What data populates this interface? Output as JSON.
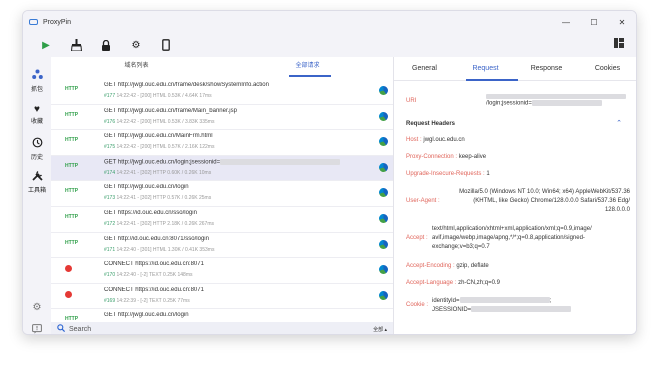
{
  "app": {
    "title": "ProxyPin"
  },
  "window_controls": {
    "minimize": "—",
    "maximize": "☐",
    "close": "✕"
  },
  "sidebar": {
    "items": [
      {
        "label": "抓包",
        "icon": "share-nodes-icon"
      },
      {
        "label": "收藏",
        "icon": "heart-icon"
      },
      {
        "label": "历史",
        "icon": "history-icon"
      },
      {
        "label": "工具箱",
        "icon": "tools-icon"
      }
    ]
  },
  "list": {
    "tabs": [
      {
        "label": "域名列表"
      },
      {
        "label": "全部请求"
      }
    ],
    "rows": [
      {
        "url": "GET http://jwgl.ouc.edu.cn/frame/desk/showSystemInfo.action",
        "meta_id": "#177",
        "meta": "14:22:42 - [200]  HTML 0.53K / 4.64K  17ms",
        "kind": "ok"
      },
      {
        "url": "GET http://jwgl.ouc.edu.cn/frame/Main_banner.jsp",
        "meta_id": "#176",
        "meta": "14:22:42 - [200]  HTML 0.53K / 3.83K  335ms",
        "kind": "ok"
      },
      {
        "url": "GET http://jwgl.ouc.edu.cn/MainFrm.html",
        "meta_id": "#175",
        "meta": "14:22:42 - [200]  HTML 0.57K / 2.16K  122ms",
        "kind": "ok"
      },
      {
        "url": "GET http://jwgl.ouc.edu.cn/login;jsessionid=",
        "meta_id": "#174",
        "meta": "14:22:41 - [302]  HTTP 0.60K / 0.26K  10ms",
        "kind": "ok"
      },
      {
        "url": "GET http://jwgl.ouc.edu.cn/login",
        "meta_id": "#173",
        "meta": "14:22:41 - [302]  HTTP 0.57K / 0.26K  25ms",
        "kind": "ok"
      },
      {
        "url": "GET https://id.ouc.edu.cn/sso/login",
        "meta_id": "#172",
        "meta": "14:22:41 - [302]  HTTP 2.18K / 0.26K  267ms",
        "kind": "ok"
      },
      {
        "url": "GET http://id.ouc.edu.cn:8071/sso/login",
        "meta_id": "#171",
        "meta": "14:22:40 - [301]  HTML 1.30K / 0.41K  353ms",
        "kind": "ok"
      },
      {
        "url": "CONNECT https://id.ouc.edu.cn:8071",
        "meta_id": "#170",
        "meta": "14:22:40 - [-2]  TEXT 0.25K  148ms",
        "kind": "err"
      },
      {
        "url": "CONNECT https://id.ouc.edu.cn:8071",
        "meta_id": "#169",
        "meta": "14:22:39 - [-2]  TEXT 0.25K  77ms",
        "kind": "err"
      },
      {
        "url": "GET http://jwgl.ouc.edu.cn/login",
        "meta_id": "",
        "meta": "",
        "kind": "ok"
      }
    ]
  },
  "search": {
    "placeholder": "Search",
    "scope": "全部 ▴"
  },
  "detail": {
    "tabs": [
      {
        "label": "General"
      },
      {
        "label": "Request"
      },
      {
        "label": "Response"
      },
      {
        "label": "Cookies"
      }
    ],
    "uri_label": "URI",
    "uri_value": "/login;jsessionid=",
    "section_title": "Request Headers",
    "headers": [
      {
        "key": "Host",
        "value": "jwgl.ouc.edu.cn"
      },
      {
        "key": "Proxy-Connection",
        "value": "keep-alive"
      },
      {
        "key": "Upgrade-Insecure-Requests",
        "value": "1"
      },
      {
        "key": "User-Agent",
        "value_lines": [
          "Mozilla/5.0 (Windows NT 10.0; Win64; x64) AppleWebKit/537.36",
          "(KHTML, like Gecko) Chrome/128.0.0.0 Safari/537.36 Edg/",
          "128.0.0.0"
        ]
      },
      {
        "key": "Accept",
        "value_lines": [
          "text/html,application/xhtml+xml,application/xml;q=0.9,image/",
          "avif,image/webp,image/apng,*/*;q=0.8,application/signed-",
          "exchange;v=b3;q=0.7"
        ]
      },
      {
        "key": "Accept-Encoding",
        "value": "gzip, deflate"
      },
      {
        "key": "Accept-Language",
        "value": "zh-CN,zh;q=0.9"
      },
      {
        "key": "Cookie",
        "value_lines": [
          "identityId=",
          "JSESSIONID="
        ],
        "suffix": ";"
      }
    ]
  },
  "colors": {
    "accent": "#3b64c8",
    "header_key": "#e0655b",
    "ok": "#2e9e48",
    "error": "#e53935"
  }
}
